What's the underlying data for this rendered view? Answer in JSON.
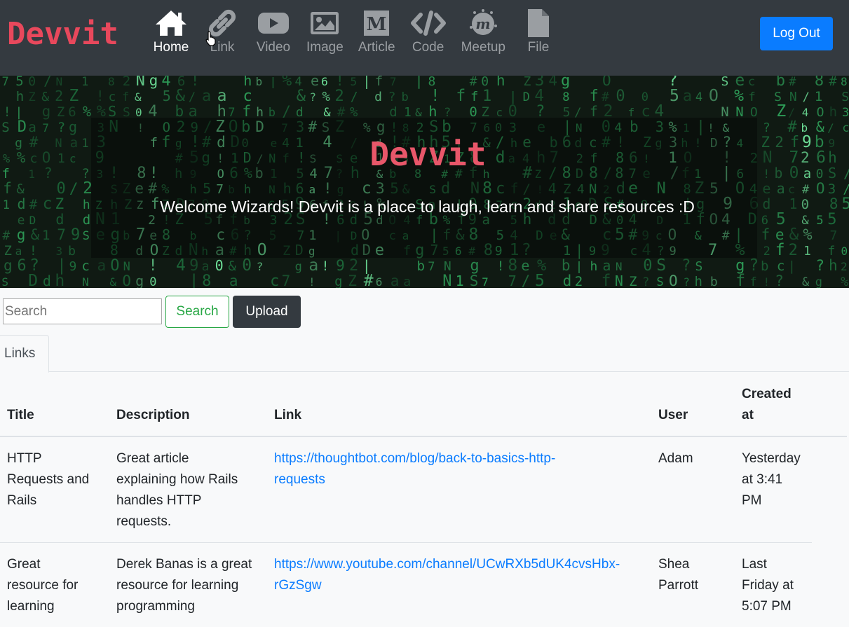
{
  "navbar": {
    "brand": "Devvit",
    "items": [
      {
        "label": "Home",
        "icon": "home-icon",
        "active": true
      },
      {
        "label": "Link",
        "icon": "link-icon",
        "active": false
      },
      {
        "label": "Video",
        "icon": "video-icon",
        "active": false
      },
      {
        "label": "Image",
        "icon": "image-icon",
        "active": false
      },
      {
        "label": "Article",
        "icon": "medium-icon",
        "active": false
      },
      {
        "label": "Code",
        "icon": "code-icon",
        "active": false
      },
      {
        "label": "Meetup",
        "icon": "meetup-icon",
        "active": false
      },
      {
        "label": "File",
        "icon": "file-icon",
        "active": false
      }
    ],
    "logout_label": "Log Out"
  },
  "hero": {
    "title": "Devvit",
    "subtitle": "Welcome Wizards! Devvit is a place to laugh, learn and share resources :D"
  },
  "toolbar": {
    "search_placeholder": "Search",
    "search_label": "Search",
    "upload_label": "Upload"
  },
  "tabs": [
    {
      "label": "Links"
    }
  ],
  "table": {
    "headers": {
      "title": "Title",
      "description": "Description",
      "link": "Link",
      "user": "User",
      "created_line1": "Created",
      "created_line2": "at"
    },
    "rows": [
      {
        "title": [
          "HTTP",
          "Requests and",
          "Rails"
        ],
        "description": [
          "Great article",
          "explaining how Rails",
          "handles HTTP",
          "requests."
        ],
        "link": [
          "https://thoughtbot.com/blog/back-to-basics-http-",
          "requests"
        ],
        "user": [
          "Adam"
        ],
        "created": [
          "Yesterday",
          "at 3:41",
          "PM"
        ]
      },
      {
        "title": [
          "Great",
          "resource for",
          "learning"
        ],
        "description": [
          "Derek Banas is a great",
          "resource for learning",
          "programming"
        ],
        "link": [
          "https://www.youtube.com/channel/UCwRXb5dUK4cvsHbx-",
          "rGzSgw"
        ],
        "user": [
          "Shea",
          "Parrott"
        ],
        "created": [
          "Last",
          "Friday at",
          "5:07 PM"
        ]
      }
    ]
  },
  "colors": {
    "navbar_bg": "#343a40",
    "brand": "#e8485c",
    "primary": "#0a7cff",
    "success": "#28a745"
  }
}
